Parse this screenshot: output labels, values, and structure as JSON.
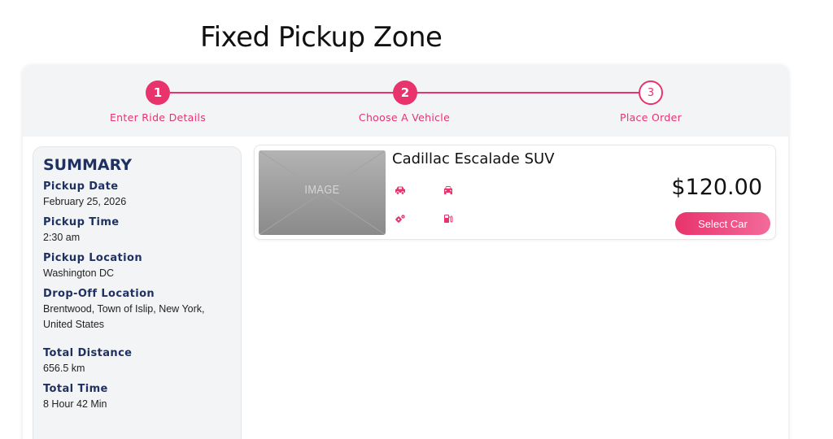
{
  "page": {
    "title": "Fixed Pickup Zone"
  },
  "stepper": {
    "steps": [
      {
        "number": "1",
        "label": "Enter Ride Details",
        "state": "done"
      },
      {
        "number": "2",
        "label": "Choose A Vehicle",
        "state": "done"
      },
      {
        "number": "3",
        "label": "Place Order",
        "state": "todo"
      }
    ]
  },
  "summary": {
    "title": "SUMMARY",
    "items": [
      {
        "label": "Pickup Date",
        "value": "February 25, 2026"
      },
      {
        "label": "Pickup Time",
        "value": "2:30 am"
      },
      {
        "label": "Pickup Location",
        "value": "Washington DC"
      },
      {
        "label": "Drop-Off Location",
        "value": "Brentwood, Town of Islip, New York, United States"
      },
      {
        "label": "Total Distance",
        "value": "656.5 km"
      },
      {
        "label": "Total Time",
        "value": "8 Hour 42 Min"
      }
    ]
  },
  "vehicle": {
    "image_placeholder": "IMAGE",
    "name": "Cadillac Escalade SUV",
    "price": "$120.00",
    "select_label": "Select Car",
    "feature_icons": [
      "car-side-icon",
      "car-front-icon",
      "gears-icon",
      "fuel-pump-icon"
    ]
  },
  "colors": {
    "accent": "#e8336d",
    "navy": "#1f3160",
    "panel": "#f3f4f6"
  }
}
